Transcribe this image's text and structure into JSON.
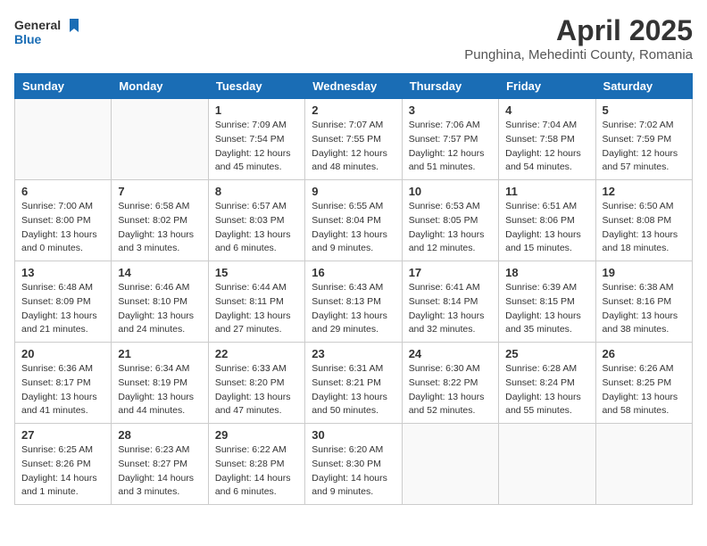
{
  "header": {
    "logo_general": "General",
    "logo_blue": "Blue",
    "title": "April 2025",
    "subtitle": "Punghina, Mehedinti County, Romania"
  },
  "days_of_week": [
    "Sunday",
    "Monday",
    "Tuesday",
    "Wednesday",
    "Thursday",
    "Friday",
    "Saturday"
  ],
  "weeks": [
    [
      {
        "day": "",
        "info": ""
      },
      {
        "day": "",
        "info": ""
      },
      {
        "day": "1",
        "info": "Sunrise: 7:09 AM\nSunset: 7:54 PM\nDaylight: 12 hours and 45 minutes."
      },
      {
        "day": "2",
        "info": "Sunrise: 7:07 AM\nSunset: 7:55 PM\nDaylight: 12 hours and 48 minutes."
      },
      {
        "day": "3",
        "info": "Sunrise: 7:06 AM\nSunset: 7:57 PM\nDaylight: 12 hours and 51 minutes."
      },
      {
        "day": "4",
        "info": "Sunrise: 7:04 AM\nSunset: 7:58 PM\nDaylight: 12 hours and 54 minutes."
      },
      {
        "day": "5",
        "info": "Sunrise: 7:02 AM\nSunset: 7:59 PM\nDaylight: 12 hours and 57 minutes."
      }
    ],
    [
      {
        "day": "6",
        "info": "Sunrise: 7:00 AM\nSunset: 8:00 PM\nDaylight: 13 hours and 0 minutes."
      },
      {
        "day": "7",
        "info": "Sunrise: 6:58 AM\nSunset: 8:02 PM\nDaylight: 13 hours and 3 minutes."
      },
      {
        "day": "8",
        "info": "Sunrise: 6:57 AM\nSunset: 8:03 PM\nDaylight: 13 hours and 6 minutes."
      },
      {
        "day": "9",
        "info": "Sunrise: 6:55 AM\nSunset: 8:04 PM\nDaylight: 13 hours and 9 minutes."
      },
      {
        "day": "10",
        "info": "Sunrise: 6:53 AM\nSunset: 8:05 PM\nDaylight: 13 hours and 12 minutes."
      },
      {
        "day": "11",
        "info": "Sunrise: 6:51 AM\nSunset: 8:06 PM\nDaylight: 13 hours and 15 minutes."
      },
      {
        "day": "12",
        "info": "Sunrise: 6:50 AM\nSunset: 8:08 PM\nDaylight: 13 hours and 18 minutes."
      }
    ],
    [
      {
        "day": "13",
        "info": "Sunrise: 6:48 AM\nSunset: 8:09 PM\nDaylight: 13 hours and 21 minutes."
      },
      {
        "day": "14",
        "info": "Sunrise: 6:46 AM\nSunset: 8:10 PM\nDaylight: 13 hours and 24 minutes."
      },
      {
        "day": "15",
        "info": "Sunrise: 6:44 AM\nSunset: 8:11 PM\nDaylight: 13 hours and 27 minutes."
      },
      {
        "day": "16",
        "info": "Sunrise: 6:43 AM\nSunset: 8:13 PM\nDaylight: 13 hours and 29 minutes."
      },
      {
        "day": "17",
        "info": "Sunrise: 6:41 AM\nSunset: 8:14 PM\nDaylight: 13 hours and 32 minutes."
      },
      {
        "day": "18",
        "info": "Sunrise: 6:39 AM\nSunset: 8:15 PM\nDaylight: 13 hours and 35 minutes."
      },
      {
        "day": "19",
        "info": "Sunrise: 6:38 AM\nSunset: 8:16 PM\nDaylight: 13 hours and 38 minutes."
      }
    ],
    [
      {
        "day": "20",
        "info": "Sunrise: 6:36 AM\nSunset: 8:17 PM\nDaylight: 13 hours and 41 minutes."
      },
      {
        "day": "21",
        "info": "Sunrise: 6:34 AM\nSunset: 8:19 PM\nDaylight: 13 hours and 44 minutes."
      },
      {
        "day": "22",
        "info": "Sunrise: 6:33 AM\nSunset: 8:20 PM\nDaylight: 13 hours and 47 minutes."
      },
      {
        "day": "23",
        "info": "Sunrise: 6:31 AM\nSunset: 8:21 PM\nDaylight: 13 hours and 50 minutes."
      },
      {
        "day": "24",
        "info": "Sunrise: 6:30 AM\nSunset: 8:22 PM\nDaylight: 13 hours and 52 minutes."
      },
      {
        "day": "25",
        "info": "Sunrise: 6:28 AM\nSunset: 8:24 PM\nDaylight: 13 hours and 55 minutes."
      },
      {
        "day": "26",
        "info": "Sunrise: 6:26 AM\nSunset: 8:25 PM\nDaylight: 13 hours and 58 minutes."
      }
    ],
    [
      {
        "day": "27",
        "info": "Sunrise: 6:25 AM\nSunset: 8:26 PM\nDaylight: 14 hours and 1 minute."
      },
      {
        "day": "28",
        "info": "Sunrise: 6:23 AM\nSunset: 8:27 PM\nDaylight: 14 hours and 3 minutes."
      },
      {
        "day": "29",
        "info": "Sunrise: 6:22 AM\nSunset: 8:28 PM\nDaylight: 14 hours and 6 minutes."
      },
      {
        "day": "30",
        "info": "Sunrise: 6:20 AM\nSunset: 8:30 PM\nDaylight: 14 hours and 9 minutes."
      },
      {
        "day": "",
        "info": ""
      },
      {
        "day": "",
        "info": ""
      },
      {
        "day": "",
        "info": ""
      }
    ]
  ]
}
